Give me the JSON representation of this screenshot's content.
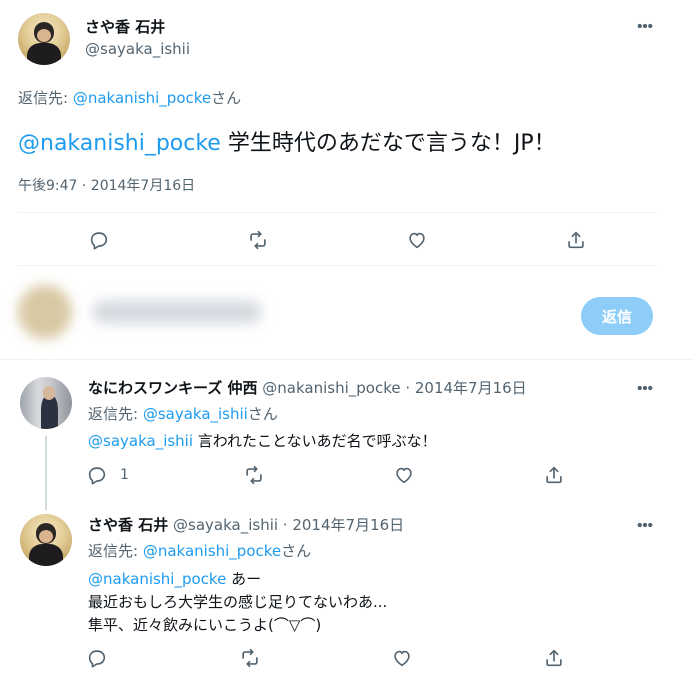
{
  "main_tweet": {
    "display_name": "さや香 石井",
    "handle": "@sayaka_ishii",
    "reply_prefix": "返信先: ",
    "reply_to": "@nakanishi_pocke",
    "reply_suffix": "さん",
    "mention": "@nakanishi_pocke",
    "text": " 学生時代のあだなで言うな！JP！",
    "timestamp": "午後9:47 · 2014年7月16日"
  },
  "compose": {
    "reply_button": "返信"
  },
  "replies": [
    {
      "display_name": "なにわスワンキーズ 仲西",
      "handle": "@nakanishi_pocke",
      "date": " · 2014年7月16日",
      "reply_prefix": "返信先: ",
      "reply_to": "@sayaka_ishii",
      "reply_suffix": "さん",
      "mention": "@sayaka_ishii",
      "text": " 言われたことないあだ名で呼ぶな！",
      "reply_count": "1"
    },
    {
      "display_name": "さや香 石井",
      "handle": "@sayaka_ishii",
      "date": " · 2014年7月16日",
      "reply_prefix": "返信先: ",
      "reply_to": "@nakanishi_pocke",
      "reply_suffix": "さん",
      "mention": "@nakanishi_pocke",
      "line1": " あー",
      "line2": "最近おもしろ大学生の感じ足りてないわあ...",
      "line3": "隼平、近々飲みにいこうよ(⌒▽⌒)"
    }
  ],
  "icons": {
    "more": "more-horizontal-icon",
    "reply": "reply-bubble-icon",
    "retweet": "retweet-icon",
    "like": "heart-icon",
    "share": "share-upload-icon"
  },
  "colors": {
    "accent": "#1d9bf0",
    "reply_button_disabled": "#8ecdf8",
    "muted_text": "#536471",
    "divider": "#eff3f4"
  }
}
